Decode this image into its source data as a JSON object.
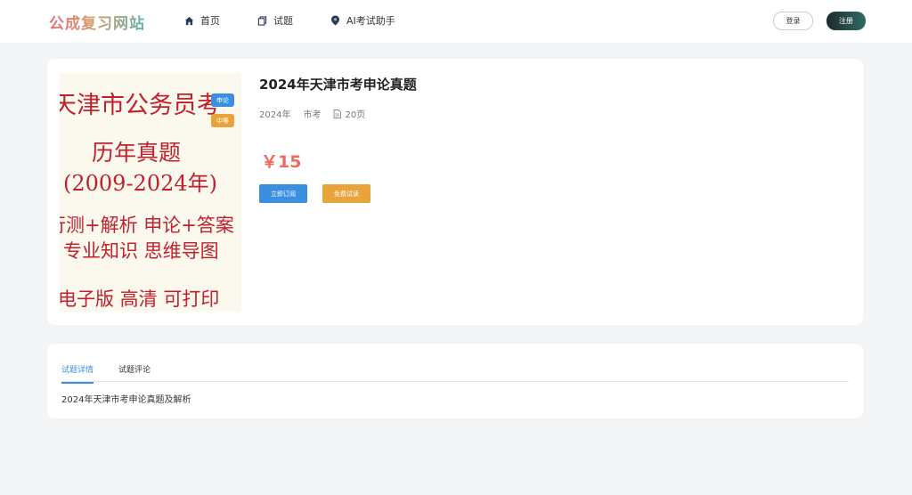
{
  "header": {
    "logo": "公成复习网站",
    "nav": [
      {
        "label": "首页",
        "icon": "home-icon"
      },
      {
        "label": "试题",
        "icon": "copy-icon"
      },
      {
        "label": "AI考试助手",
        "icon": "ai-icon"
      }
    ],
    "login": "登录",
    "register": "注册"
  },
  "product": {
    "cover": {
      "lines": [
        "天津市公务员考",
        "历年真题",
        "(2009-2024年)",
        "行测+解析 申论+答案",
        "专业知识 思维导图",
        "电子版  高清  可打印"
      ],
      "badges": [
        {
          "label": "申论",
          "color": "#3b8fe0"
        },
        {
          "label": "中等",
          "color": "#e8a33a"
        }
      ]
    },
    "title": "2024年天津市考申论真题",
    "year": "2024年",
    "category": "市考",
    "pages": "20页",
    "price": "￥15",
    "subscribe": "立即订阅",
    "trial": "免费试读"
  },
  "detail": {
    "tabs": [
      {
        "label": "试题详情",
        "active": true
      },
      {
        "label": "试题评论",
        "active": false
      }
    ],
    "content": "2024年天津市考申论真题及解析"
  },
  "colors": {
    "accent": "#3b8fe0",
    "price": "#f06a5b",
    "trial": "#e8a33a",
    "cover_text": "#c0212d"
  }
}
